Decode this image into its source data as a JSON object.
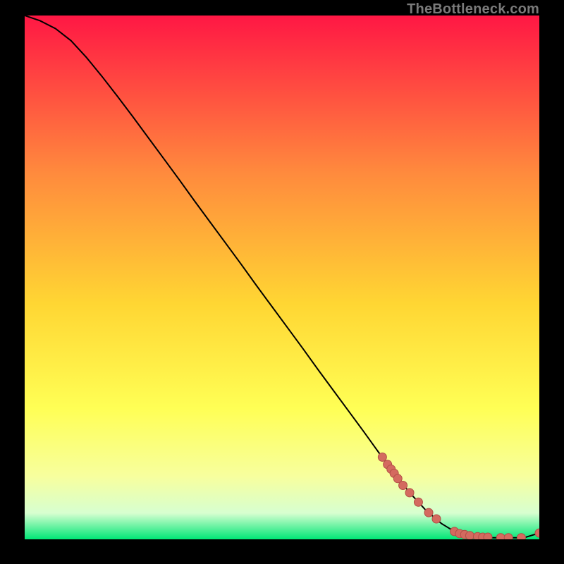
{
  "watermark": "TheBottleneck.com",
  "colors": {
    "gradient_top": "#ff1744",
    "gradient_mid1": "#ff8a3d",
    "gradient_mid2": "#ffd633",
    "gradient_mid3": "#ffff55",
    "gradient_mid4": "#f7ff9e",
    "gradient_mid5": "#d7ffd0",
    "gradient_bottom": "#00e676",
    "line": "#000000",
    "marker_fill": "#d46a5f",
    "marker_stroke": "#b24f46",
    "background": "#000000"
  },
  "chart_data": {
    "type": "line",
    "title": "",
    "xlabel": "",
    "ylabel": "",
    "xlim": [
      0,
      100
    ],
    "ylim": [
      0,
      100
    ],
    "grid": false,
    "legend": false,
    "series": [
      {
        "name": "curve",
        "x": [
          0,
          3,
          6,
          9,
          12,
          15,
          18,
          21,
          24,
          27,
          30,
          33,
          36,
          39,
          42,
          45,
          48,
          51,
          54,
          57,
          60,
          63,
          66,
          69,
          72,
          75,
          78,
          81,
          83,
          85,
          87,
          89,
          91,
          93,
          95,
          97,
          100
        ],
        "y": [
          100,
          99.0,
          97.5,
          95.2,
          92.0,
          88.4,
          84.6,
          80.7,
          76.7,
          72.7,
          68.7,
          64.6,
          60.6,
          56.6,
          52.6,
          48.5,
          44.5,
          40.5,
          36.5,
          32.4,
          28.4,
          24.4,
          20.4,
          16.3,
          12.3,
          8.7,
          5.5,
          3.0,
          1.8,
          1.0,
          0.6,
          0.4,
          0.3,
          0.3,
          0.3,
          0.3,
          1.2
        ]
      }
    ],
    "markers": {
      "name": "points",
      "x": [
        69.5,
        70.5,
        71.2,
        71.8,
        72.5,
        73.5,
        74.8,
        76.5,
        78.5,
        80.0,
        83.5,
        84.5,
        85.5,
        86.5,
        88.0,
        89.0,
        90.0,
        92.5,
        94.0,
        96.5,
        100.0
      ],
      "y": [
        15.7,
        14.3,
        13.4,
        12.6,
        11.6,
        10.3,
        8.9,
        7.1,
        5.1,
        3.9,
        1.5,
        1.1,
        0.9,
        0.7,
        0.5,
        0.4,
        0.4,
        0.3,
        0.3,
        0.3,
        1.2
      ]
    }
  }
}
